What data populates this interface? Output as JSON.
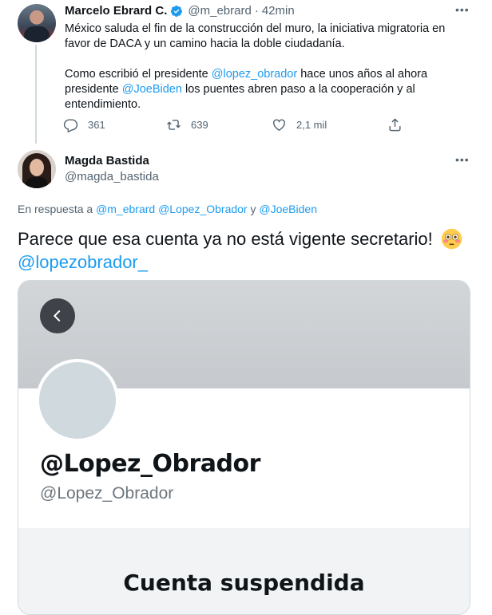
{
  "parent_tweet": {
    "author_name": "Marcelo Ebrard C.",
    "handle": "@m_ebrard",
    "separator": "·",
    "time": "42min",
    "paragraph1": "México saluda el fin de la construcción del muro, la iniciativa migratoria en favor de DACA y un camino hacia la doble ciudadanía.",
    "p2_part1": "Como escribió el presidente ",
    "p2_mention1": "@lopez_obrador",
    "p2_part2": " hace unos años al ahora presidente ",
    "p2_mention2": "@JoeBiden",
    "p2_part3": " los puentes abren paso a la cooperación y al entendimiento.",
    "reply_count": "361",
    "retweet_count": "639",
    "like_count": "2,1 mil"
  },
  "reply_tweet": {
    "author_name": "Magda Bastida",
    "handle": "@magda_bastida",
    "replying_prefix": "En respuesta a ",
    "replying_to1": "@m_ebrard",
    "replying_to2": "@Lopez_Obrador",
    "replying_and": " y ",
    "replying_to3": "@JoeBiden",
    "text": "Parece que esa cuenta ya no está vigente secretario!",
    "mention": "@lopezobrador_"
  },
  "embedded_image": {
    "profile_title": "@Lopez_Obrador",
    "profile_handle": "@Lopez_Obrador",
    "status": "Cuenta suspendida"
  },
  "icons": {
    "verified": "verified-badge-icon",
    "reply": "reply-icon",
    "retweet": "retweet-icon",
    "like": "heart-icon",
    "share": "share-icon",
    "more": "more-icon",
    "back": "back-arrow-icon",
    "emoji": "flushed-face-emoji"
  },
  "colors": {
    "link": "#1d9bf0",
    "muted": "#536471",
    "verified": "#1d9bf0"
  }
}
